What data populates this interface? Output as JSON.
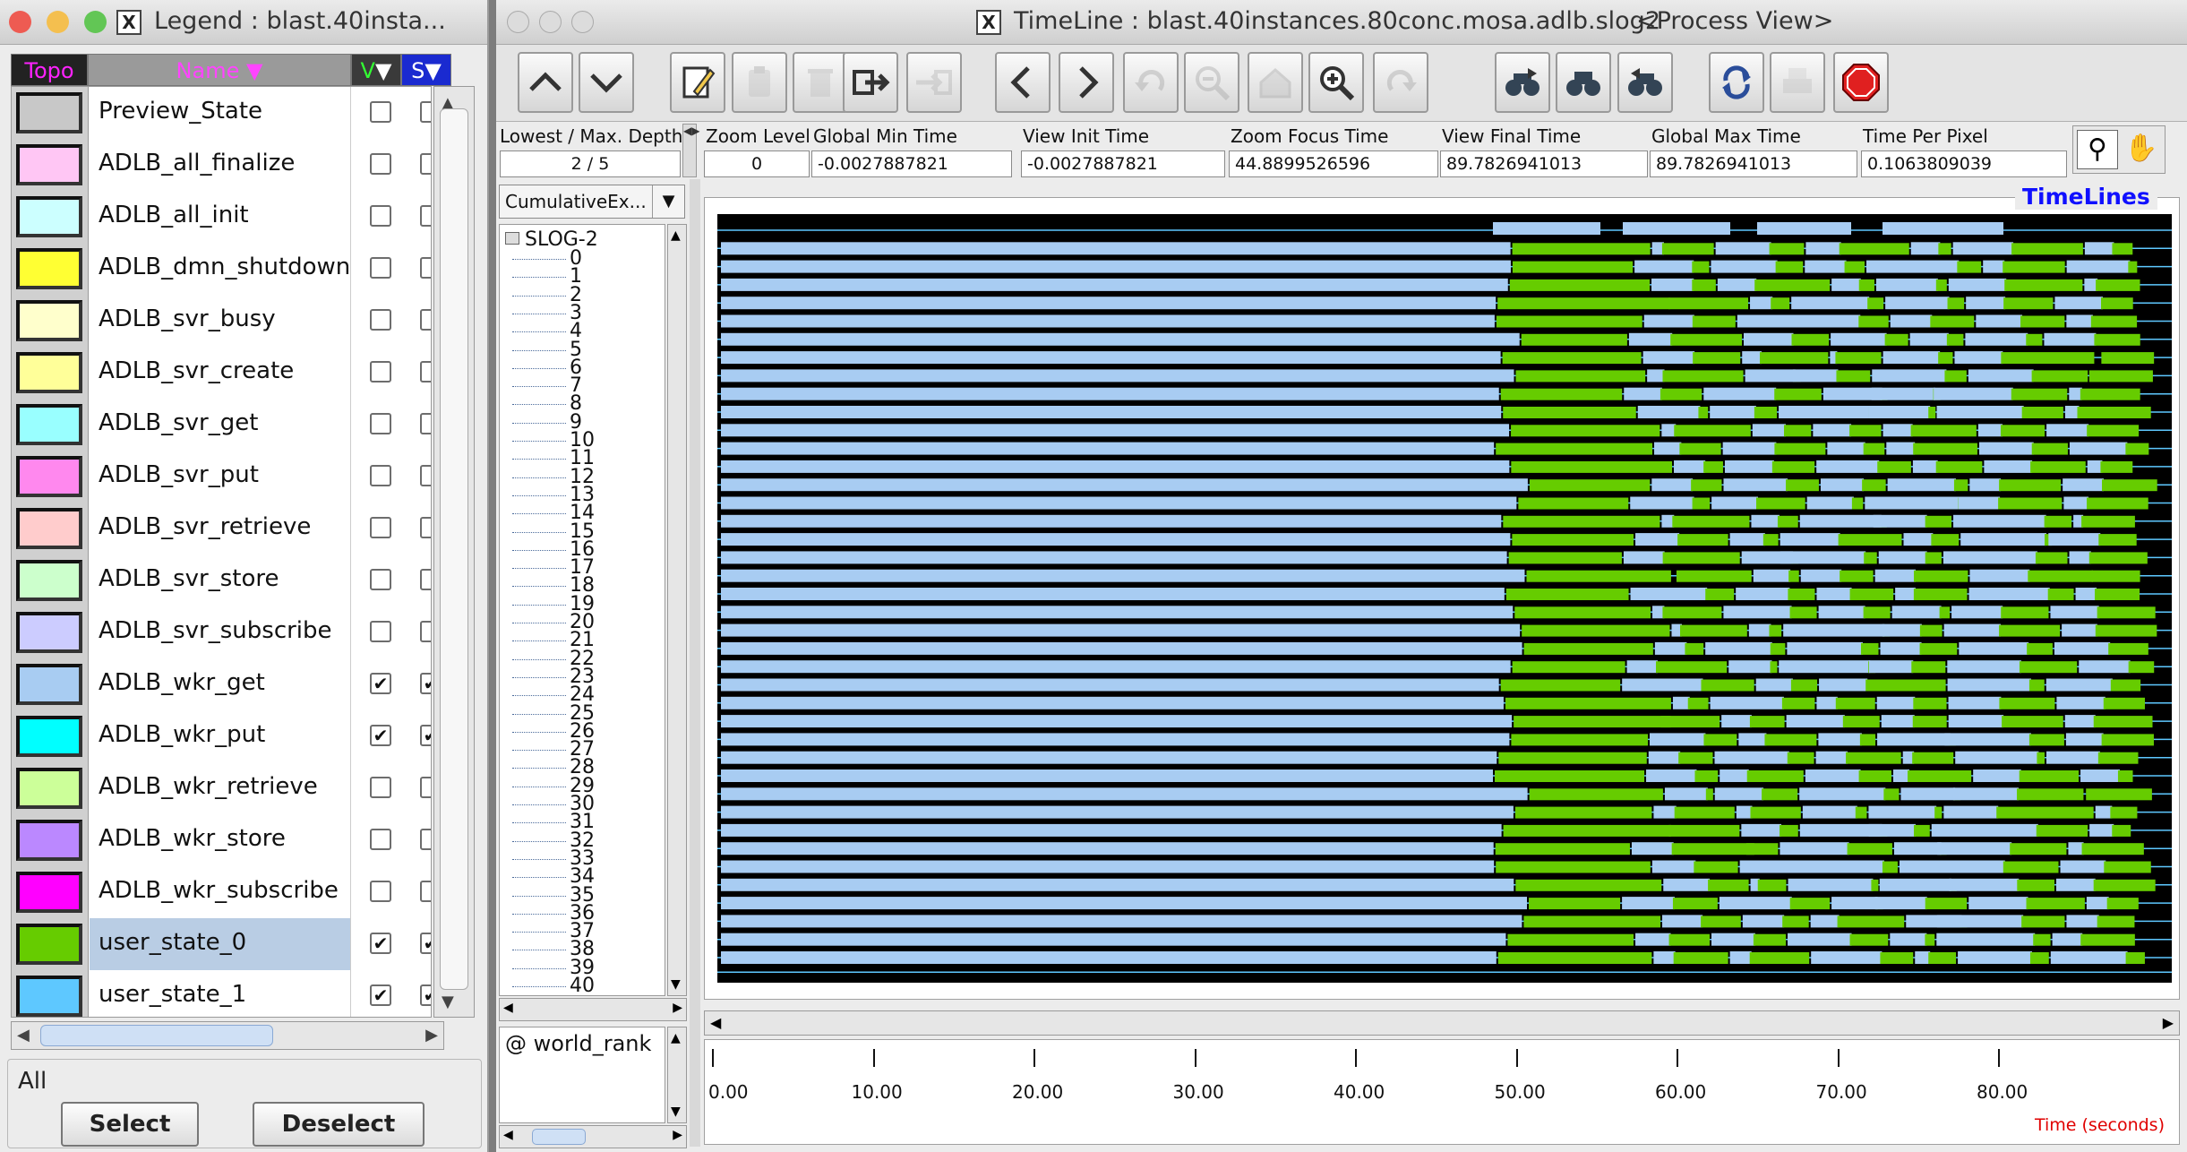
{
  "legend_window": {
    "title": "Legend : blast.40insta...",
    "columns": {
      "topo": "Topo",
      "name": "Name",
      "v": "V",
      "s": "S"
    },
    "items": [
      {
        "name": "Preview_State",
        "color": "#c8c8c8",
        "v": false,
        "s": false
      },
      {
        "name": "ADLB_all_finalize",
        "color": "#ffc6f4",
        "v": false,
        "s": false
      },
      {
        "name": "ADLB_all_init",
        "color": "#ccffff",
        "v": false,
        "s": false
      },
      {
        "name": "ADLB_dmn_shutdown",
        "color": "#ffff33",
        "v": false,
        "s": false
      },
      {
        "name": "ADLB_svr_busy",
        "color": "#ffffcc",
        "v": false,
        "s": false
      },
      {
        "name": "ADLB_svr_create",
        "color": "#ffff99",
        "v": false,
        "s": false
      },
      {
        "name": "ADLB_svr_get",
        "color": "#99ffff",
        "v": false,
        "s": false
      },
      {
        "name": "ADLB_svr_put",
        "color": "#ff88ee",
        "v": false,
        "s": false
      },
      {
        "name": "ADLB_svr_retrieve",
        "color": "#ffcccc",
        "v": false,
        "s": false
      },
      {
        "name": "ADLB_svr_store",
        "color": "#ccffcc",
        "v": false,
        "s": false
      },
      {
        "name": "ADLB_svr_subscribe",
        "color": "#ccccff",
        "v": false,
        "s": false
      },
      {
        "name": "ADLB_wkr_get",
        "color": "#a8ccf2",
        "v": true,
        "s": true
      },
      {
        "name": "ADLB_wkr_put",
        "color": "#00ffff",
        "v": true,
        "s": true
      },
      {
        "name": "ADLB_wkr_retrieve",
        "color": "#ccff99",
        "v": false,
        "s": false
      },
      {
        "name": "ADLB_wkr_store",
        "color": "#bb88ff",
        "v": false,
        "s": false
      },
      {
        "name": "ADLB_wkr_subscribe",
        "color": "#ff00ff",
        "v": false,
        "s": false
      },
      {
        "name": "user_state_0",
        "color": "#66cc00",
        "v": true,
        "s": true,
        "selected": true
      },
      {
        "name": "user_state_1",
        "color": "#5ec8ff",
        "v": true,
        "s": true
      }
    ],
    "group_label": "All",
    "select_label": "Select",
    "deselect_label": "Deselect"
  },
  "timeline_window": {
    "title": "TimeLine : blast.40instances.80conc.mosa.adlb.slog2",
    "view_mode": "<Process View>",
    "toolbar": [
      "up-icon",
      "down-icon",
      "edit-icon",
      "clipboard-icon",
      "trash-icon",
      "export-icon",
      "import-icon",
      "back-icon",
      "forward-icon",
      "undo-icon",
      "zoom-out-icon",
      "home-icon",
      "zoom-in-icon",
      "redo-icon",
      "search-forward-icon",
      "binoculars-icon",
      "search-backward-icon",
      "refresh-icon",
      "print-icon",
      "stop-icon"
    ],
    "fields": {
      "depth_label": "Lowest / Max. Depth",
      "depth_value": "2 / 5",
      "zoom_level_label": "Zoom Level",
      "zoom_level_value": "0",
      "global_min_label": "Global Min Time",
      "global_min_value": "-0.0027887821",
      "view_init_label": "View  Init Time",
      "view_init_value": "-0.0027887821",
      "zoom_focus_label": "Zoom Focus Time",
      "zoom_focus_value": "44.8899526596",
      "view_final_label": "View Final Time",
      "view_final_value": "89.7826941013",
      "global_max_label": "Global Max Time",
      "global_max_value": "89.7826941013",
      "time_per_pixel_label": "Time Per Pixel",
      "time_per_pixel_value": "0.1063809039"
    },
    "combo_value": "CumulativeEx...",
    "tree_root": "SLOG-2",
    "ranks": [
      "0",
      "1",
      "2",
      "3",
      "4",
      "5",
      "6",
      "7",
      "8",
      "9",
      "10",
      "11",
      "12",
      "13",
      "14",
      "15",
      "16",
      "17",
      "18",
      "19",
      "20",
      "21",
      "22",
      "23",
      "24",
      "25",
      "26",
      "27",
      "28",
      "29",
      "30",
      "31",
      "32",
      "33",
      "34",
      "35",
      "36",
      "37",
      "38",
      "39",
      "40"
    ],
    "label_field": "@ world_rank",
    "canvas_title": "TimeLines",
    "axis_ticks": [
      "0.00",
      "10.00",
      "20.00",
      "30.00",
      "40.00",
      "50.00",
      "60.00",
      "70.00",
      "80.00"
    ],
    "axis_unit": "Time (seconds)",
    "colors": {
      "wkr_get": "#a8ccf2",
      "user_state_0": "#66cc00",
      "background": "#000000",
      "rank_line": "#5ec8ff"
    }
  }
}
